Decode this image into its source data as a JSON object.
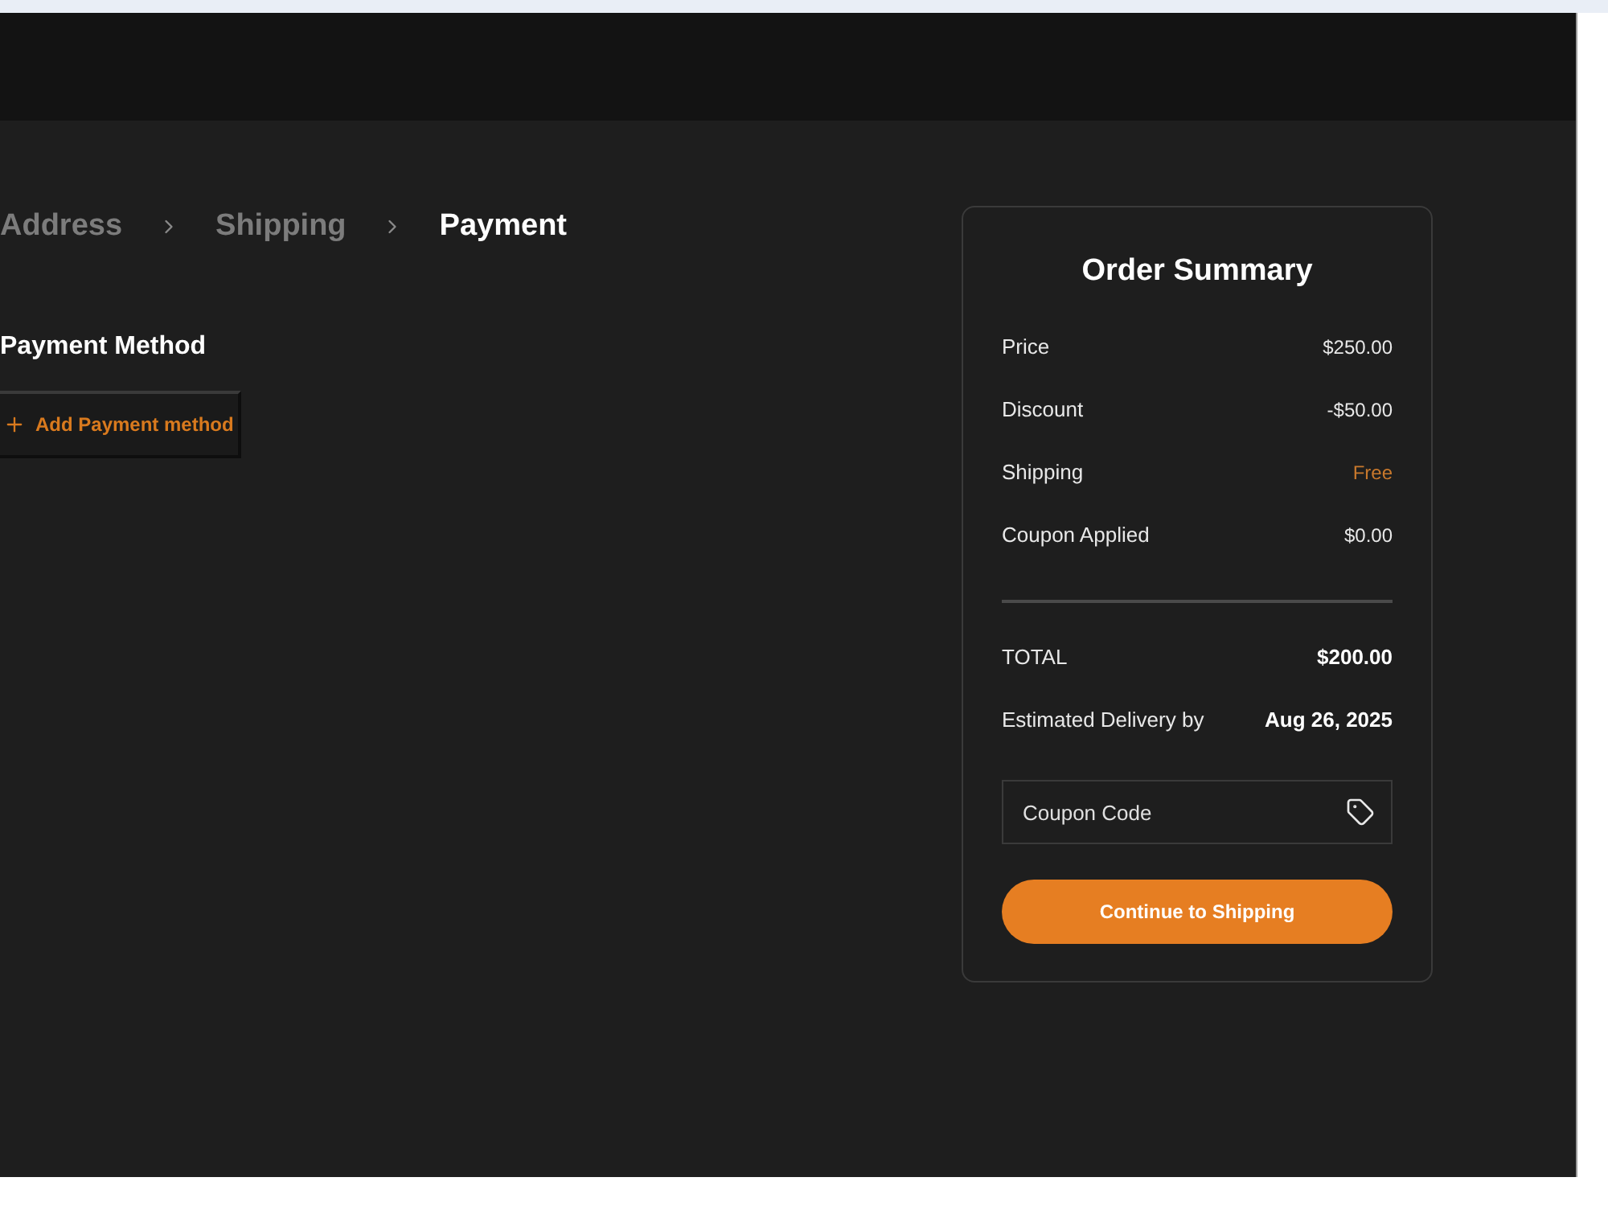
{
  "breadcrumb": [
    {
      "label": "Address",
      "selected": false
    },
    {
      "label": "Shipping",
      "selected": false
    },
    {
      "label": "Payment",
      "selected": true
    }
  ],
  "payment_method": {
    "heading": "Payment Method",
    "add_button": "Add Payment method"
  },
  "order_summary": {
    "title": "Order Summary",
    "rows": [
      {
        "label": "Price",
        "value": "$250.00",
        "kind": "amount"
      },
      {
        "label": "Discount",
        "value": "-$50.00",
        "kind": "amount"
      },
      {
        "label": "Shipping",
        "value": "Free",
        "kind": "accent"
      },
      {
        "label": "Coupon Applied",
        "value": "$0.00",
        "kind": "amount"
      }
    ],
    "totals": [
      {
        "label": "TOTAL",
        "value": "$200.00"
      },
      {
        "label": "Estimated Delivery by",
        "value": "Aug 26, 2025"
      }
    ],
    "coupon": {
      "placeholder": "Coupon Code"
    },
    "continue_button": "Continue to Shipping"
  }
}
